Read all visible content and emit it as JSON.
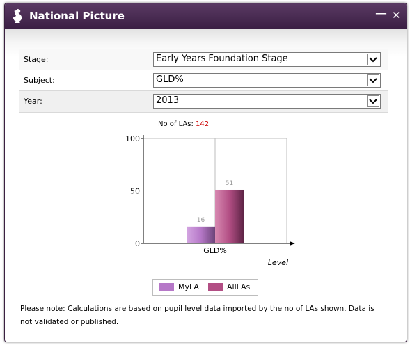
{
  "window": {
    "title": "National Picture",
    "minimize_label": "—",
    "close_label": "✕",
    "logo_icon": "dragon-icon"
  },
  "form": {
    "stage": {
      "label": "Stage:",
      "value": "Early Years Foundation Stage"
    },
    "subject": {
      "label": "Subject:",
      "value": "GLD%"
    },
    "year": {
      "label": "Year:",
      "value": "2013"
    }
  },
  "no_of_las": {
    "label": "No of LAs:",
    "value": "142"
  },
  "chart_data": {
    "type": "bar",
    "categories": [
      "GLD%"
    ],
    "series": [
      {
        "name": "MyLA",
        "values": [
          16
        ],
        "color": "#b678c8"
      },
      {
        "name": "AllLAs",
        "values": [
          51
        ],
        "color": "#b24e84"
      }
    ],
    "data_labels": [
      "16",
      "51"
    ],
    "y_ticks": [
      "100",
      "50",
      "0"
    ],
    "xlabel": "Level",
    "ylim": [
      0,
      100
    ],
    "grid": true,
    "legend_position": "bottom"
  },
  "note": "Please note: Calculations are based on pupil level data imported by the no of LAs shown. Data is not validated or published."
}
